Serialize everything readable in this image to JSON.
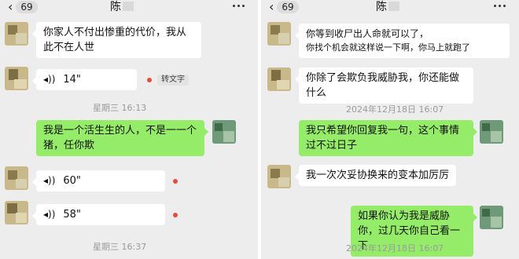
{
  "left": {
    "back_count": "69",
    "title": "陈",
    "messages": {
      "m1": "你家人不付出惨重的代价，我从此不在人世",
      "m2_duration": "14\"",
      "m2_action": "转文字",
      "ts1": "星期三 16:13",
      "m3": "我是一个活生生的人，不是一一个猪，任你欺",
      "m4_duration": "60\"",
      "m5_duration": "58\"",
      "ts2": "星期三 16:37"
    }
  },
  "right": {
    "back_count": "69",
    "title": "陈",
    "messages": {
      "m1_line1": "你等到收尸出人命就可以了，",
      "m1_line2": "你找个机会就这样说一下啊，你马上就跑了",
      "m2": "你除了会欺负我威胁我，你还能做什么",
      "ts1": "2024年12月18日 16:07",
      "m3": "我只希望你回复我一句，这个事情过不过日子",
      "m4": "我一次次妥协换来的变本加厉厉",
      "m5": "如果你认为我是威胁你，过几天你自己看一下",
      "ts2": "2024年12月18日 16:07"
    }
  },
  "icons": {
    "back": "chevron-left-icon",
    "more": "more-dots-icon",
    "voice": "voice-wave-icon"
  },
  "colors": {
    "background": "#ededed",
    "incoming_bubble": "#ffffff",
    "outgoing_bubble": "#95ec69",
    "unread_dot": "#e84a3e",
    "timestamp": "#9a9a9a"
  }
}
